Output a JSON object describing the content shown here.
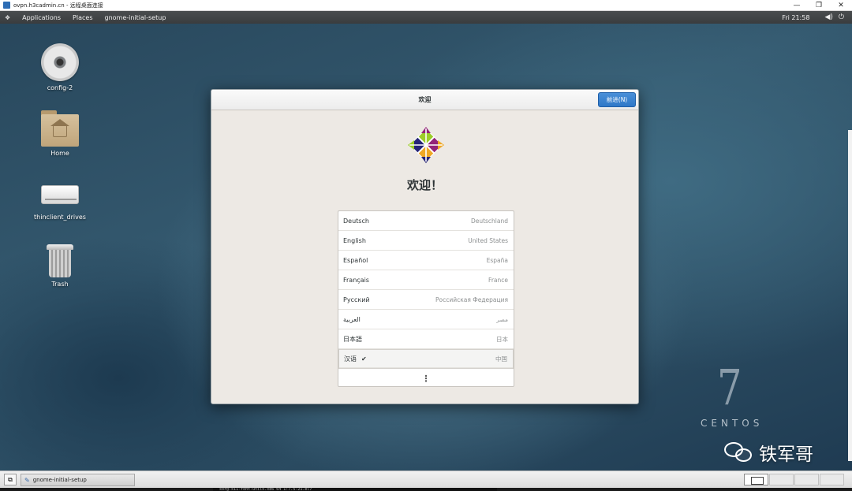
{
  "rdp_window": {
    "title": "ovpn.h3cadmin.cn - 远程桌面连接",
    "controls": {
      "minimize": "—",
      "restore": "❐",
      "close": "✕"
    }
  },
  "topbar": {
    "applications": "Applications",
    "places": "Places",
    "active_app": "gnome-initial-setup",
    "clock": "Fri 21:58",
    "volume_glyph": "◀)",
    "power_glyph": "⏻"
  },
  "desktop_icons": [
    {
      "label": "config-2",
      "icon": "disc-icon"
    },
    {
      "label": "Home",
      "icon": "home-folder-icon"
    },
    {
      "label": "thinclient_drives",
      "icon": "drive-icon"
    },
    {
      "label": "Trash",
      "icon": "trash-icon"
    }
  ],
  "watermarks": {
    "centos_number": "7",
    "centos_word": "CENTOS",
    "wechat_name": "铁军哥"
  },
  "dialog": {
    "title": "欢迎",
    "next_button": "前进(N)",
    "heading": "欢迎！",
    "languages": [
      {
        "name": "Deutsch",
        "region": "Deutschland"
      },
      {
        "name": "English",
        "region": "United States"
      },
      {
        "name": "Español",
        "region": "España"
      },
      {
        "name": "Français",
        "region": "France"
      },
      {
        "name": "Русский",
        "region": "Российская Федерация"
      },
      {
        "name": "العربية",
        "region": "مصر"
      },
      {
        "name": "日本語",
        "region": "日本"
      },
      {
        "name": "汉语",
        "region": "中国",
        "selected": true,
        "check": "✔"
      }
    ],
    "more_glyph": "⋮"
  },
  "taskbar": {
    "task_label": "gnome-initial-setup",
    "task_glyph": "✎",
    "show_desktop_glyph": "⧉"
  },
  "host_terminal_text": "xorg-x11-font-utils.x86_64 1:7.5-21.el7",
  "colors": {
    "accent_button": "#3584e4",
    "dialog_bg": "#ede9e4",
    "topbar_bg": "#3a3c3e"
  }
}
